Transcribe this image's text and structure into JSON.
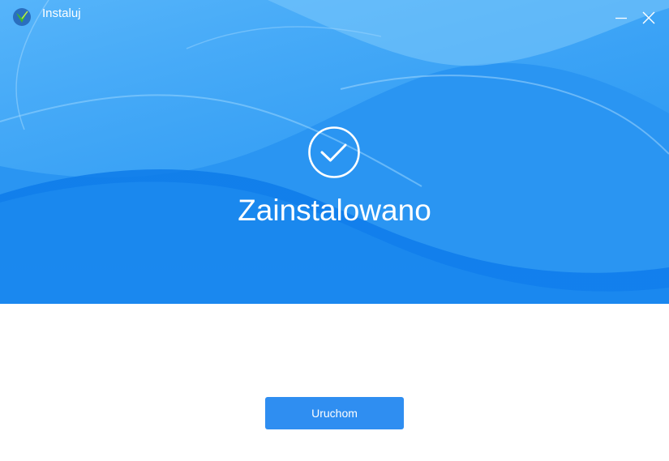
{
  "window": {
    "title": "Instaluj",
    "minimize_icon": "minimize-icon",
    "close_icon": "close-icon"
  },
  "status": {
    "icon": "checkmark-circle-icon",
    "title": "Zainstalowano"
  },
  "actions": {
    "launch_label": "Uruchom"
  },
  "colors": {
    "hero_blue": "#1a86ee",
    "button_blue": "#2f8ef1",
    "text_white": "#ffffff",
    "logo_green": "#3fb531"
  }
}
